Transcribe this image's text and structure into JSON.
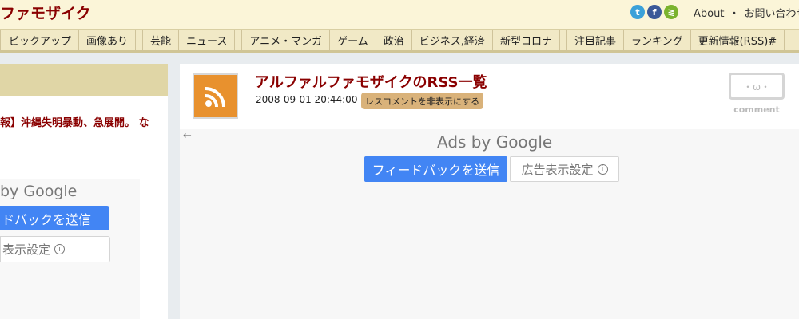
{
  "site": {
    "title": "ファモザイク"
  },
  "social": {
    "twitter_glyph": "t",
    "facebook_glyph": "f",
    "feedly_glyph": "≷"
  },
  "header": {
    "about": "About",
    "separator": "・",
    "contact": "お問い合わせ"
  },
  "nav": {
    "items": [
      "ピックアップ",
      "画像あり",
      "芸能",
      "ニュース",
      "アニメ・マンガ",
      "ゲーム",
      "政治",
      "ビジネス,経済",
      "新型コロナ",
      "注目記事",
      "ランキング",
      "更新情報(RSS)#"
    ]
  },
  "left": {
    "headline": "報】沖縄失明暴動、急展開。 な",
    "ads_by": "by Google",
    "feedback_label": "ドバックを送信",
    "ad_settings_label": "表示設定"
  },
  "entry": {
    "title": "アルファルファモザイクのRSS一覧",
    "date": "2008-09-01 20:44:00",
    "hide_comments_label": "レスコメントを非表示にする",
    "comment_face": "・ω・",
    "comment_label": "comment"
  },
  "ad": {
    "back_arrow": "←",
    "ads_by": "Ads by Google",
    "feedback_label": "フィードバックを送信",
    "ad_settings_label": "広告表示設定",
    "info_glyph": "i"
  },
  "colors": {
    "brand": "#8a0000",
    "header_bg": "#fbf5d8",
    "nav_bg": "#f1e9c6",
    "ad_blue": "#4285f4",
    "rss_orange": "#e8912e"
  }
}
